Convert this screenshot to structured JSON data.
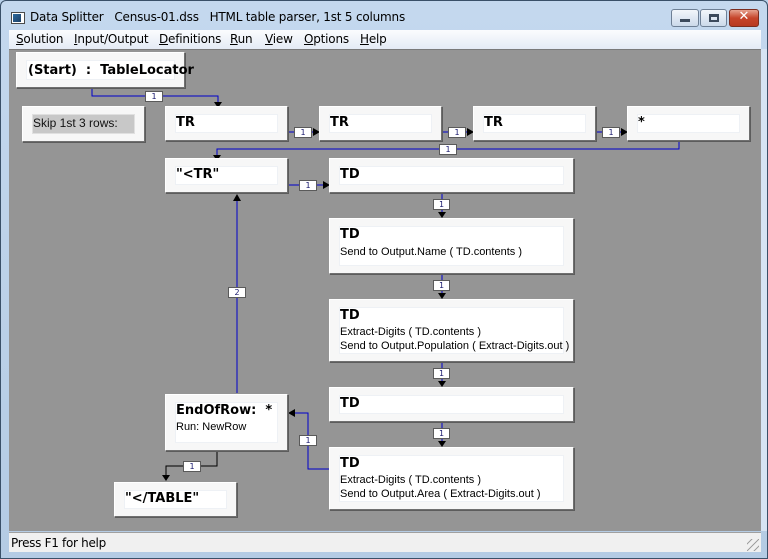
{
  "window": {
    "title": "Data Splitter   Census-01.dss   HTML table parser, 1st 5 columns",
    "controls": {
      "minimize": "minimize",
      "maximize": "maximize",
      "close": "close"
    }
  },
  "menubar": {
    "items": [
      {
        "label": "Solution",
        "accel": "S",
        "rest": "olution"
      },
      {
        "label": "Input/Output",
        "accel": "I",
        "rest": "nput/Output"
      },
      {
        "label": "Definitions",
        "accel": "D",
        "rest": "efinitions"
      },
      {
        "label": "Run",
        "accel": "R",
        "rest": "un"
      },
      {
        "label": "View",
        "accel": "V",
        "rest": "iew"
      },
      {
        "label": "Options",
        "accel": "O",
        "rest": "ptions"
      },
      {
        "label": "Help",
        "accel": "H",
        "rest": "elp"
      }
    ]
  },
  "diagram": {
    "nodes": {
      "start": {
        "title": "(Start)  :  TableLocator"
      },
      "skip": {
        "note": "Skip 1st 3 rows:"
      },
      "tr1": {
        "title": "TR"
      },
      "tr2": {
        "title": "TR"
      },
      "tr3": {
        "title": "TR"
      },
      "star": {
        "title": "*"
      },
      "ltr": {
        "title": "\"<TR\""
      },
      "td1": {
        "title": "TD"
      },
      "td2": {
        "title": "TD",
        "lines": [
          "Send to Output.Name ( TD.contents )"
        ]
      },
      "td3": {
        "title": "TD",
        "lines": [
          "Extract-Digits ( TD.contents )",
          "Send to Output.Population ( Extract-Digits.out )"
        ]
      },
      "td4": {
        "title": "TD"
      },
      "td5": {
        "title": "TD",
        "lines": [
          "Extract-Digits ( TD.contents )",
          "Send to Output.Area ( Extract-Digits.out )"
        ]
      },
      "endofrow": {
        "title": "EndOfRow:  *",
        "lines": [
          "Run: NewRow"
        ]
      },
      "endtable": {
        "title": "\"</TABLE\""
      }
    },
    "edge_labels": {
      "start_tr1": "1",
      "tr1_tr2": "1",
      "tr2_tr3": "1",
      "tr3_star": "1",
      "star_ltr": "1",
      "ltr_td1": "1",
      "td1_td2": "1",
      "td2_td3": "1",
      "td3_td4": "1",
      "td4_td5": "1",
      "td5_endofrow": "1",
      "endofrow_ltr": "2",
      "endofrow_endtable": "1"
    },
    "colors": {
      "wire": "#0000cc",
      "wire_alt": "#000000",
      "canvas": "#959595"
    }
  },
  "statusbar": {
    "text": "Press F1 for help"
  }
}
